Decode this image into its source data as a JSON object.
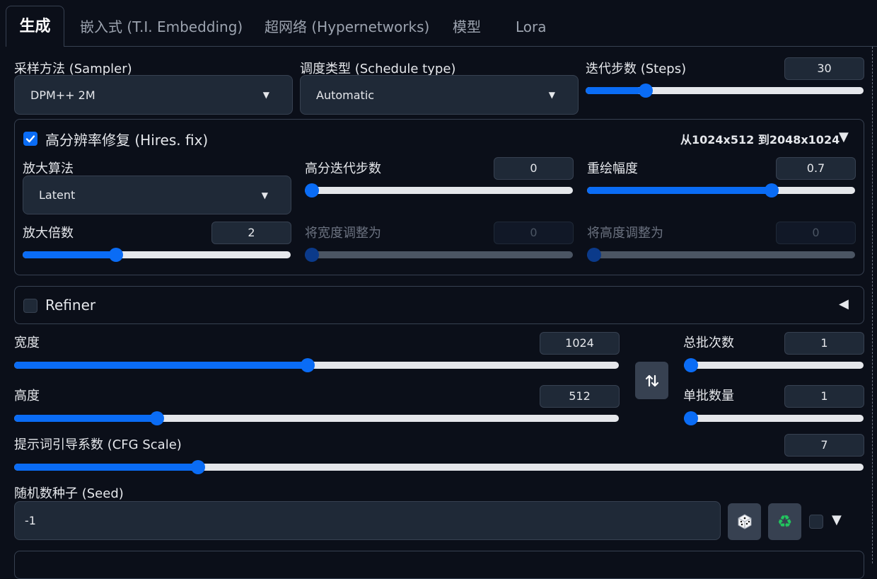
{
  "tabs": [
    {
      "label": "生成",
      "active": true
    },
    {
      "label": "嵌入式 (T.I. Embedding)"
    },
    {
      "label": "超网络 (Hypernetworks)"
    },
    {
      "label": "模型"
    },
    {
      "label": "Lora"
    }
  ],
  "sampler": {
    "label": "采样方法 (Sampler)",
    "value": "DPM++ 2M"
  },
  "schedule": {
    "label": "调度类型 (Schedule type)",
    "value": "Automatic"
  },
  "steps": {
    "label": "迭代步数 (Steps)",
    "value": "30",
    "fraction": 0.2
  },
  "hires": {
    "label": "高分辨率修复 (Hires. fix)",
    "checked": true,
    "summary": "从1024x512 到2048x1024",
    "toggle": "▼",
    "upscaler": {
      "label": "放大算法",
      "value": "Latent"
    },
    "hires_steps": {
      "label": "高分迭代步数",
      "value": "0",
      "fraction": 0.0
    },
    "denoise": {
      "label": "重绘幅度",
      "value": "0.7",
      "fraction": 0.7
    },
    "scale": {
      "label": "放大倍数",
      "value": "2",
      "fraction": 0.34
    },
    "resize_w": {
      "label": "将宽度调整为",
      "value": "0",
      "fraction": 0.0
    },
    "resize_h": {
      "label": "将高度调整为",
      "value": "0",
      "fraction": 0.0
    }
  },
  "refiner": {
    "label": "Refiner",
    "checked": false,
    "toggle": "◀"
  },
  "width": {
    "label": "宽度",
    "value": "1024",
    "fraction": 0.485
  },
  "height": {
    "label": "高度",
    "value": "512",
    "fraction": 0.23
  },
  "swap_icon": "swap-vertical-icon",
  "batch_count": {
    "label": "总批次数",
    "value": "1",
    "fraction": 0.0
  },
  "batch_size": {
    "label": "单批数量",
    "value": "1",
    "fraction": 0.0
  },
  "cfg": {
    "label": "提示词引导系数 (CFG Scale)",
    "value": "7",
    "fraction": 0.212
  },
  "seed": {
    "label": "随机数种子 (Seed)",
    "value": "-1",
    "extra_toggle": "▼"
  },
  "colors": {
    "accent": "#0a6cf5",
    "bg": "#0b0f19",
    "panel": "#1f2937",
    "border": "#374151"
  }
}
